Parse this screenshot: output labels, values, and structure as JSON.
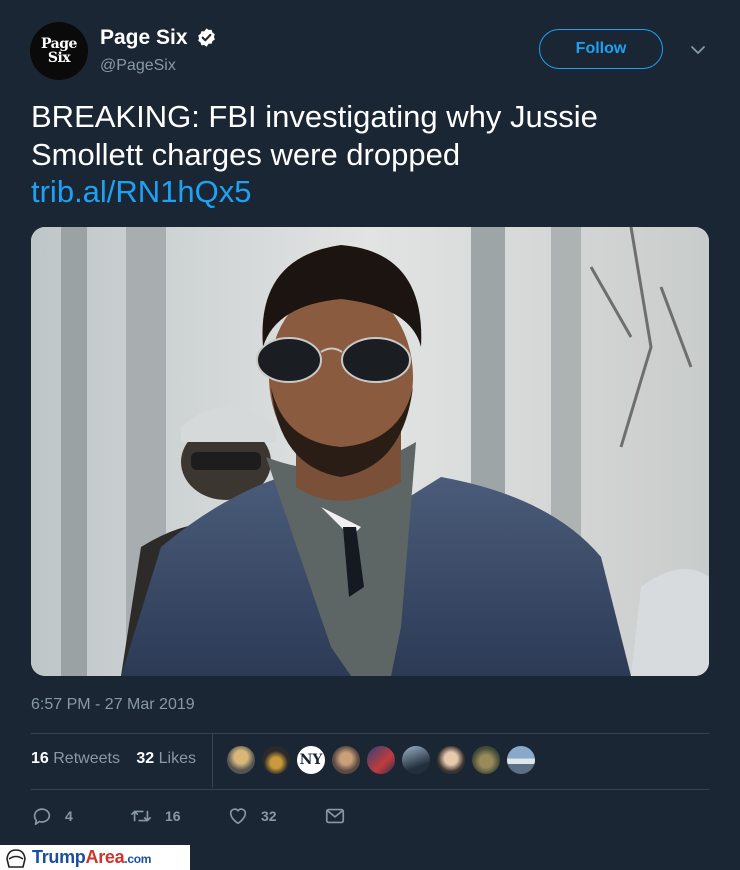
{
  "account": {
    "avatar_line1": "Page",
    "avatar_line2": "Six",
    "display_name": "Page Six",
    "handle": "@PageSix",
    "verified": true
  },
  "header": {
    "follow_label": "Follow",
    "menu_icon": "chevron-down-icon"
  },
  "tweet": {
    "text": "BREAKING: FBI investigating why Jussie Smollett charges were dropped",
    "link": "trib.al/RN1hQx5",
    "timestamp": "6:57 PM - 27 Mar 2019"
  },
  "stats": {
    "retweets_count": "16",
    "retweets_label": "Retweets",
    "likes_count": "32",
    "likes_label": "Likes"
  },
  "actions": {
    "reply_count": "4",
    "retweet_count": "16",
    "like_count": "32"
  },
  "watermark": {
    "brand_a": "Trump",
    "brand_b": "Area",
    "brand_tld": ".com"
  },
  "colors": {
    "background": "#1b2634",
    "accent": "#1da1f2",
    "muted": "#8899a6"
  }
}
